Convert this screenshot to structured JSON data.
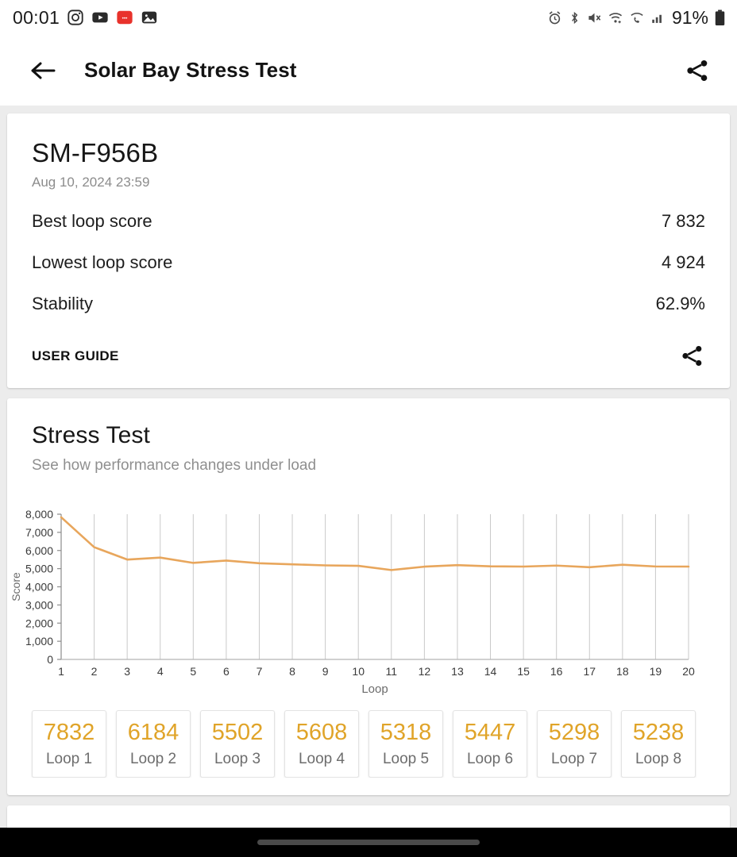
{
  "statusbar": {
    "clock": "00:01",
    "battery_text": "91%",
    "left_icons": [
      "instagram-icon",
      "youtube-icon",
      "reddit-icon",
      "gallery-icon"
    ],
    "right_icons": [
      "alarm-icon",
      "bluetooth-icon",
      "mute-icon",
      "wifi-icon",
      "wifi-calling-icon",
      "signal-icon",
      "battery-icon"
    ]
  },
  "appbar": {
    "back_icon": "back-arrow-icon",
    "title": "Solar Bay Stress Test",
    "share_icon": "share-icon"
  },
  "device_card": {
    "name": "SM-F956B",
    "date": "Aug 10, 2024 23:59",
    "rows": [
      {
        "key": "Best loop score",
        "value": "7 832"
      },
      {
        "key": "Lowest loop score",
        "value": "4 924"
      },
      {
        "key": "Stability",
        "value": "62.9%"
      }
    ],
    "user_guide_label": "USER GUIDE",
    "share_icon": "share-icon"
  },
  "stress_test": {
    "title": "Stress Test",
    "subtitle": "See how performance changes under load",
    "loop_tiles": [
      {
        "score": "7832",
        "label": "Loop 1"
      },
      {
        "score": "6184",
        "label": "Loop 2"
      },
      {
        "score": "5502",
        "label": "Loop 3"
      },
      {
        "score": "5608",
        "label": "Loop 4"
      },
      {
        "score": "5318",
        "label": "Loop 5"
      },
      {
        "score": "5447",
        "label": "Loop 6"
      },
      {
        "score": "5298",
        "label": "Loop 7"
      },
      {
        "score": "5238",
        "label": "Loop 8"
      }
    ]
  },
  "colors": {
    "line": "#e8a65c",
    "score_text": "#e0a429",
    "page_background": "#ececec",
    "card": "#ffffff",
    "grid": "#c9c9c9"
  },
  "chart_data": {
    "type": "line",
    "title": "",
    "xlabel": "Loop",
    "ylabel": "Score",
    "x": [
      1,
      2,
      3,
      4,
      5,
      6,
      7,
      8,
      9,
      10,
      11,
      12,
      13,
      14,
      15,
      16,
      17,
      18,
      19,
      20
    ],
    "categories": [
      "1",
      "2",
      "3",
      "4",
      "5",
      "6",
      "7",
      "8",
      "9",
      "10",
      "11",
      "12",
      "13",
      "14",
      "15",
      "16",
      "17",
      "18",
      "19",
      "20"
    ],
    "values": [
      7832,
      6184,
      5502,
      5608,
      5318,
      5447,
      5298,
      5238,
      5180,
      5155,
      4924,
      5110,
      5195,
      5130,
      5115,
      5170,
      5080,
      5215,
      5120,
      5115
    ],
    "series": [
      {
        "name": "Score",
        "values": [
          7832,
          6184,
          5502,
          5608,
          5318,
          5447,
          5298,
          5238,
          5180,
          5155,
          4924,
          5110,
          5195,
          5130,
          5115,
          5170,
          5080,
          5215,
          5120,
          5115
        ]
      }
    ],
    "ylim": [
      0,
      8000
    ],
    "xlim": [
      1,
      20
    ],
    "ytick_labels": [
      "0",
      "1,000",
      "2,000",
      "3,000",
      "4,000",
      "5,000",
      "6,000",
      "7,000",
      "8,000"
    ],
    "yticks": [
      0,
      1000,
      2000,
      3000,
      4000,
      5000,
      6000,
      7000,
      8000
    ],
    "grid": "vertical",
    "legend": "none"
  }
}
